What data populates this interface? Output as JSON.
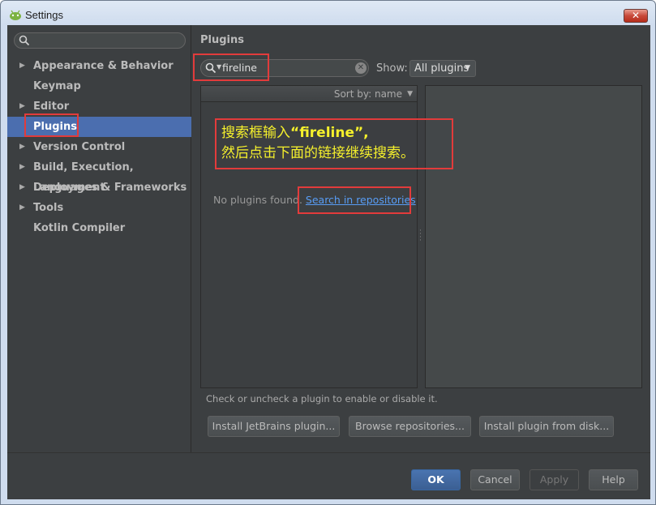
{
  "window": {
    "title": "Settings",
    "close_label": "✕"
  },
  "sidebar": {
    "search_placeholder": "",
    "items": [
      {
        "label": "Appearance & Behavior",
        "expandable": true,
        "selected": false
      },
      {
        "label": "Keymap",
        "expandable": false,
        "selected": false
      },
      {
        "label": "Editor",
        "expandable": true,
        "selected": false
      },
      {
        "label": "Plugins",
        "expandable": false,
        "selected": true
      },
      {
        "label": "Version Control",
        "expandable": true,
        "selected": false
      },
      {
        "label": "Build, Execution, Deployment",
        "expandable": true,
        "selected": false
      },
      {
        "label": "Languages & Frameworks",
        "expandable": true,
        "selected": false
      },
      {
        "label": "Tools",
        "expandable": true,
        "selected": false
      },
      {
        "label": "Kotlin Compiler",
        "expandable": false,
        "selected": false
      }
    ]
  },
  "plugins": {
    "title": "Plugins",
    "search_value": "fireline",
    "show_label": "Show:",
    "show_selected": "All plugins",
    "sort_label": "Sort by: name",
    "empty_text": "No plugins found.",
    "search_link": "Search in repositories",
    "hint": "Check or uncheck a plugin to enable or disable it.",
    "buttons": {
      "install_jetbrains": "Install JetBrains plugin...",
      "browse": "Browse repositories...",
      "install_disk": "Install plugin from disk..."
    }
  },
  "footer": {
    "ok": "OK",
    "cancel": "Cancel",
    "apply": "Apply",
    "help": "Help"
  },
  "annotation": {
    "line1_prefix": "搜索框输入",
    "line1_quote_open": "“",
    "line1_keyword": "fireline",
    "line1_quote_close": "”,",
    "line2": "然后点击下面的链接继续搜索。"
  },
  "colors": {
    "background": "#3c3f41",
    "selection": "#4b6eaf",
    "link": "#589df6",
    "annotation_box": "#e23b3b",
    "annotation_text": "#f5f02c"
  }
}
